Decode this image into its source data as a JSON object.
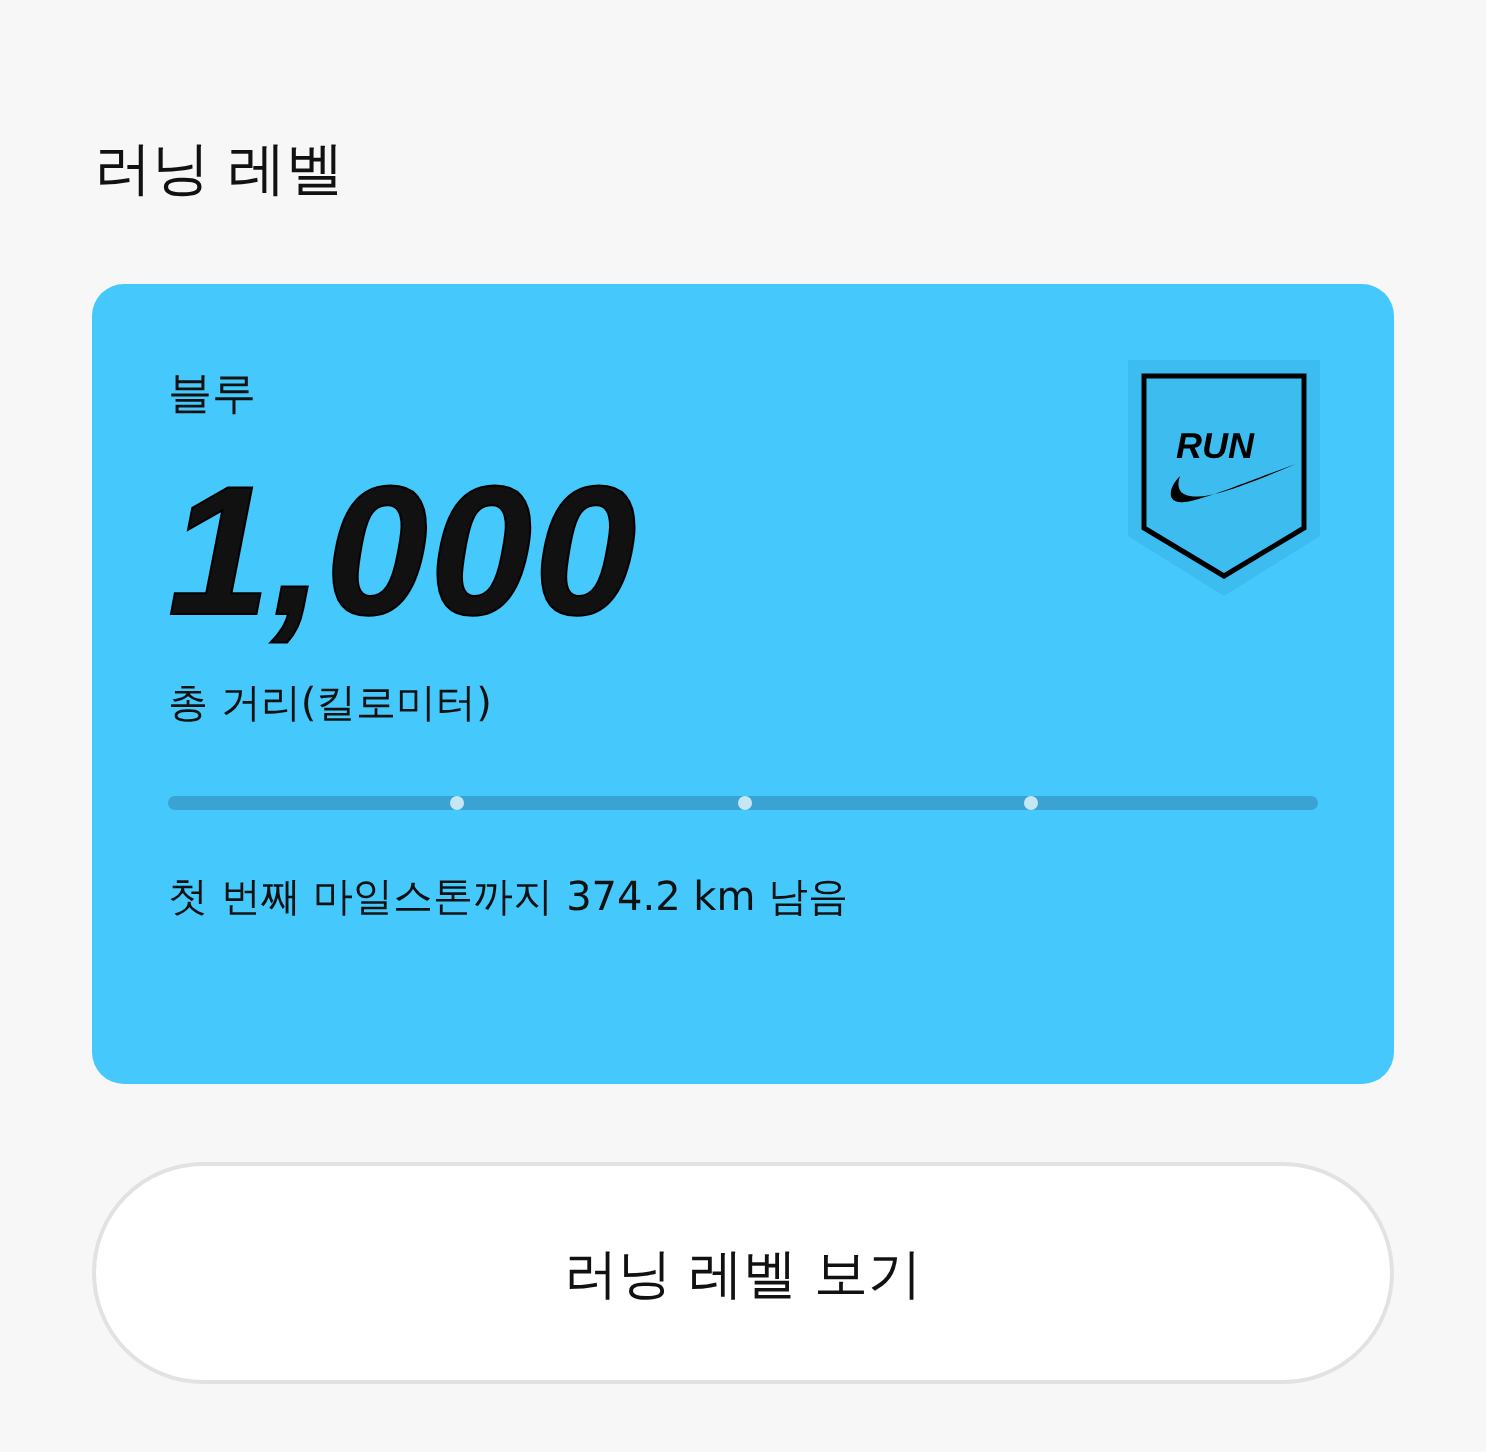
{
  "section_title": "러닝 레벨",
  "level_card": {
    "level_name": "블루",
    "color": "#45c8fc",
    "badge_text": "RUN",
    "total": "1,000",
    "total_label": "총 거리(킬로미터)",
    "remaining": "첫 번째 마일스톤까지 374.2 km 남음"
  },
  "button": "러닝 레벨 보기"
}
